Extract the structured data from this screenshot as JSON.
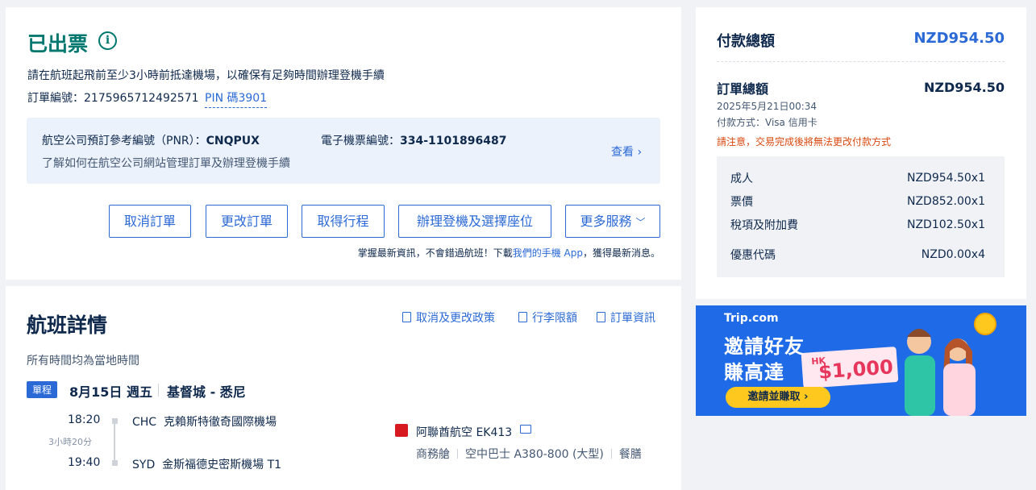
{
  "status": {
    "title": "已出票",
    "notice": "請在航班起飛前至少3小時前抵達機場，以確保有足夠時間辦理登機手續",
    "order_label": "訂單編號：",
    "order_number": "2175965712492571",
    "pin": "PIN 碼3901",
    "pnr_label": "航空公司預訂參考編號（PNR）：",
    "pnr_value": "CNQPUX",
    "ticket_label": "電子機票編號：",
    "ticket_value": "334-1101896487",
    "pnr_help": "了解如何在航空公司網站管理訂單及辦理登機手續",
    "view_link": "查看",
    "buttons": {
      "cancel": "取消訂單",
      "change": "更改訂單",
      "itinerary": "取得行程",
      "checkin": "辦理登機及選擇座位",
      "more": "更多服務"
    },
    "app_note_before": "掌握最新資訊，不會錯過航班！下載",
    "app_note_link": "我們的手機 App",
    "app_note_after": "，獲得最新消息。"
  },
  "flight": {
    "title": "航班詳情",
    "tz_note": "所有時間均為當地時間",
    "links": {
      "policy": "取消及更改政策",
      "baggage": "行李限額",
      "order_info": "訂單資訊"
    },
    "segment": {
      "tag": "單程",
      "date": "8月15日 週五",
      "route": "基督城 - 悉尼",
      "depart_time": "18:20",
      "depart_code": "CHC",
      "depart_airport": "克賴斯特徹奇國際機場",
      "duration": "3小時20分",
      "arrive_time": "19:40",
      "arrive_code": "SYD",
      "arrive_airport": "金斯福德史密斯機場 T1",
      "airline": "阿聯酋航空 EK413",
      "cabin": "商務艙",
      "aircraft": "空中巴士 A380-800 (大型)",
      "meal": "餐膳"
    }
  },
  "payment": {
    "title": "付款總額",
    "total": "NZD954.50",
    "order_title": "訂單總額",
    "order_total": "NZD954.50",
    "date": "2025年5月21日00:34",
    "method": "付款方式：Visa 信用卡",
    "warning": "請注意，交易完成後將無法更改付款方式",
    "breakdown": [
      {
        "label": "成人",
        "value": "NZD954.50x1"
      },
      {
        "label": "票價",
        "value": "NZD852.00x1"
      },
      {
        "label": "稅項及附加費",
        "value": "NZD102.50x1"
      },
      {
        "label": "優惠代碼",
        "value": "NZD0.00x4"
      }
    ]
  },
  "promo": {
    "brand": "Trip.com",
    "line1": "邀請好友",
    "line2": "賺高達",
    "currency": "HK",
    "amount": "$1,000",
    "cta": "邀請並賺取 ›"
  },
  "colors": {
    "issued_green": "#00776f",
    "link_blue": "#2b6ad6",
    "warning_orange": "#d9480f",
    "promo_blue": "#1f6ae6"
  }
}
